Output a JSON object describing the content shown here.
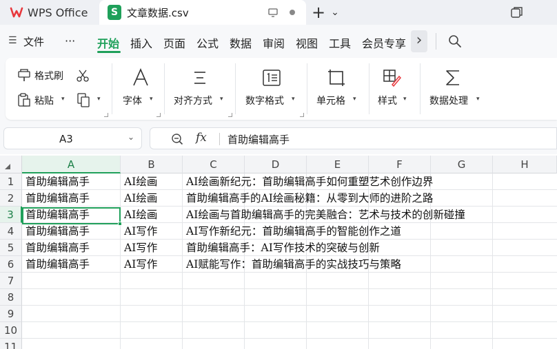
{
  "titlebar": {
    "app_name": "WPS Office",
    "doc_tab": "文章数据.csv",
    "doc_icon_letter": "S",
    "new_tab_symbol": "+",
    "new_tab_dropdown": "⌄"
  },
  "menu": {
    "hamburger": "☰",
    "file": "文件",
    "more": "···",
    "items": [
      "开始",
      "插入",
      "页面",
      "公式",
      "数据",
      "审阅",
      "视图",
      "工具",
      "会员专享"
    ],
    "scroll_right": "›"
  },
  "toolbar": {
    "format_painter": "格式刷",
    "paste": "粘贴",
    "font": "字体",
    "align": "对齐方式",
    "number_format": "数字格式",
    "cell": "单元格",
    "style": "样式",
    "data_processing": "数据处理"
  },
  "formula_bar": {
    "cell_ref": "A3",
    "fx_label": "fx",
    "content": "首助编辑高手"
  },
  "sheet": {
    "columns": [
      "A",
      "B",
      "C",
      "D",
      "E",
      "F",
      "G",
      "H"
    ],
    "rows": [
      "1",
      "2",
      "3",
      "4",
      "5",
      "6",
      "7",
      "8",
      "9",
      "10",
      "11"
    ],
    "data": [
      {
        "a": "首助编辑高手",
        "b": "AI绘画",
        "c": "AI绘画新纪元：首助编辑高手如何重塑艺术创作边界"
      },
      {
        "a": "首助编辑高手",
        "b": "AI绘画",
        "c": "首助编辑高手的AI绘画秘籍：从零到大师的进阶之路"
      },
      {
        "a": "首助编辑高手",
        "b": "AI绘画",
        "c": "AI绘画与首助编辑高手的完美融合：艺术与技术的创新碰撞"
      },
      {
        "a": "首助编辑高手",
        "b": "AI写作",
        "c": "AI写作新纪元：首助编辑高手的智能创作之道"
      },
      {
        "a": "首助编辑高手",
        "b": "AI写作",
        "c": "首助编辑高手：AI写作技术的突破与创新"
      },
      {
        "a": "首助编辑高手",
        "b": "AI写作",
        "c": "AI赋能写作：首助编辑高手的实战技巧与策略"
      }
    ]
  },
  "colors": {
    "accent": "#1fa05a",
    "wps_red": "#e8383d"
  }
}
